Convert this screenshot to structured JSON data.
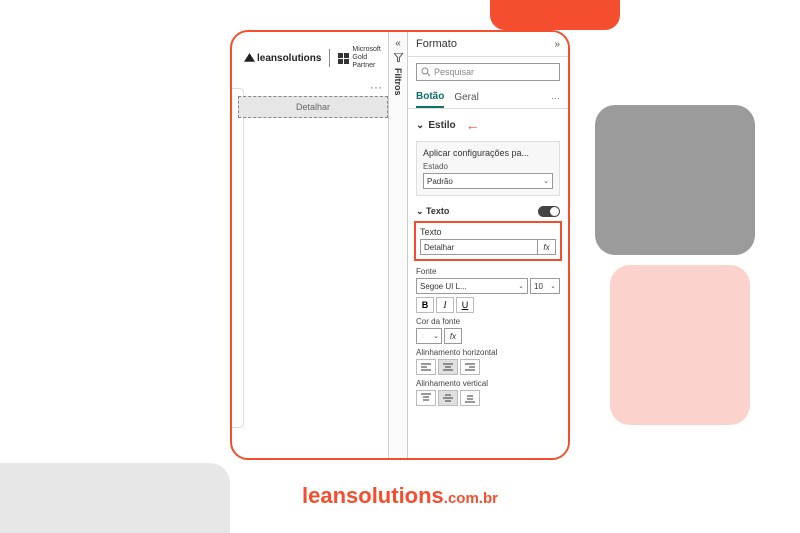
{
  "branding": {
    "leansolutions": "leansolutions",
    "ms_partner_l1": "Microsoft",
    "ms_partner_l2": "Gold Partner",
    "footer_main": "leansolutions",
    "footer_suffix": ".com.br"
  },
  "canvas": {
    "button_text": "Detalhar",
    "more": "···"
  },
  "filtros": {
    "collapse": "«",
    "label": "Filtros"
  },
  "format": {
    "title": "Formato",
    "expand": "»",
    "search_placeholder": "Pesquisar",
    "tabs": {
      "botao": "Botão",
      "geral": "Geral",
      "more": "···"
    },
    "estilo": {
      "label": "Estilo"
    },
    "aplicar": {
      "title": "Aplicar configurações pa...",
      "estado_label": "Estado",
      "estado_value": "Padrão"
    },
    "texto_section": "Texto",
    "texto": {
      "label": "Texto",
      "value": "Detalhar",
      "fx": "fx"
    },
    "fonte": {
      "label": "Fonte",
      "family": "Segoe UI L...",
      "size": "10",
      "bold": "B",
      "italic": "I",
      "underline": "U"
    },
    "cor": {
      "label": "Cor da fonte",
      "fx": "fx"
    },
    "halign": {
      "label": "Alinhamento horizontal"
    },
    "valign": {
      "label": "Alinhamento vertical"
    }
  }
}
